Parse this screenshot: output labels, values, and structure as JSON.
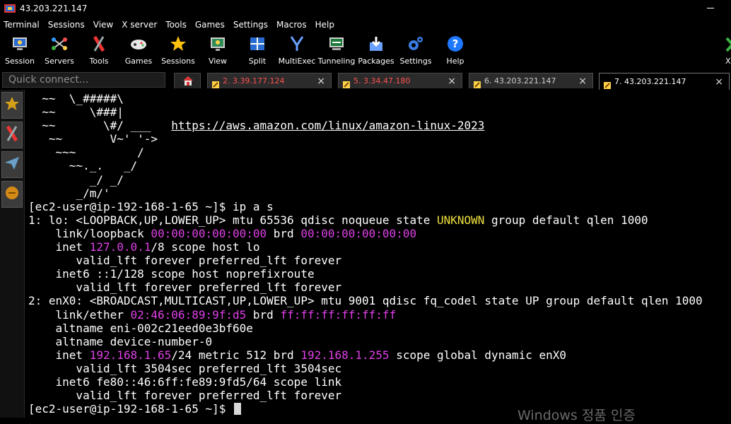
{
  "window": {
    "title": "43.203.221.147"
  },
  "menu": [
    "Terminal",
    "Sessions",
    "View",
    "X server",
    "Tools",
    "Games",
    "Settings",
    "Macros",
    "Help"
  ],
  "toolbar": [
    {
      "label": "Session",
      "icon": "session-icon"
    },
    {
      "label": "Servers",
      "icon": "servers-icon"
    },
    {
      "label": "Tools",
      "icon": "tools-icon"
    },
    {
      "label": "Games",
      "icon": "games-icon"
    },
    {
      "label": "Sessions",
      "icon": "sessions-star-icon"
    },
    {
      "label": "View",
      "icon": "view-icon"
    },
    {
      "label": "Split",
      "icon": "split-icon"
    },
    {
      "label": "MultiExec",
      "icon": "multiexec-icon"
    },
    {
      "label": "Tunneling",
      "icon": "tunneling-icon"
    },
    {
      "label": "Packages",
      "icon": "packages-icon"
    },
    {
      "label": "Settings",
      "icon": "settings-icon"
    },
    {
      "label": "Help",
      "icon": "help-icon"
    }
  ],
  "toolbar_right": {
    "label": "X se",
    "icon": "x-server-icon"
  },
  "quick_connect": {
    "placeholder": "Quick connect..."
  },
  "tabs": [
    {
      "label": "2. 3.39.177.124",
      "color": "#ff5050",
      "active": false
    },
    {
      "label": "5. 3.34.47.180",
      "color": "#ff5050",
      "active": false
    },
    {
      "label": "6. 43.203.221.147",
      "color": "#cfcfcf",
      "active": false
    },
    {
      "label": "7. 43.203.221.147",
      "color": "#ffffff",
      "active": true
    }
  ],
  "sidebar": [
    {
      "icon": "star-icon"
    },
    {
      "icon": "tools-icon"
    },
    {
      "icon": "send-icon"
    },
    {
      "icon": "macros-icon"
    }
  ],
  "terminal": {
    "lines": [
      [
        {
          "t": "  ~~  \\_#####\\"
        }
      ],
      [
        {
          "t": "  ~~     \\###|"
        }
      ],
      [
        {
          "t": "  ~~       \\#/ ___   "
        },
        {
          "t": "https://aws.amazon.com/linux/amazon-linux-2023",
          "s": "url"
        }
      ],
      [
        {
          "t": "   ~~       V~' '->"
        }
      ],
      [
        {
          "t": "    ~~~         /"
        }
      ],
      [
        {
          "t": "      ~~._.   _/"
        }
      ],
      [
        {
          "t": "         _/ _/"
        }
      ],
      [
        {
          "t": "       _/m/'"
        }
      ],
      [
        {
          "t": "[ec2-user@ip-192-168-1-65 ~]$ ip a s"
        }
      ],
      [
        {
          "t": "1: lo: <LOOPBACK,UP,LOWER_UP> mtu 65536 qdisc noqueue state "
        },
        {
          "t": "UNKNOWN",
          "s": "yel"
        },
        {
          "t": " group default qlen 1000"
        }
      ],
      [
        {
          "t": "    link/loopback "
        },
        {
          "t": "00:00:00:00:00:00",
          "s": "mag"
        },
        {
          "t": " brd "
        },
        {
          "t": "00:00:00:00:00:00",
          "s": "mag"
        }
      ],
      [
        {
          "t": "    inet "
        },
        {
          "t": "127.0.0.1",
          "s": "mag"
        },
        {
          "t": "/8 scope host lo"
        }
      ],
      [
        {
          "t": "       valid_lft forever preferred_lft forever"
        }
      ],
      [
        {
          "t": "    inet6 ::1/128 scope host noprefixroute"
        }
      ],
      [
        {
          "t": "       valid_lft forever preferred_lft forever"
        }
      ],
      [
        {
          "t": "2: enX0: <BROADCAST,MULTICAST,UP,LOWER_UP> mtu 9001 qdisc fq_codel state UP group default qlen 1000"
        }
      ],
      [
        {
          "t": "    link/ether "
        },
        {
          "t": "02:46:06:89:9f:d5",
          "s": "mag"
        },
        {
          "t": " brd "
        },
        {
          "t": "ff:ff:ff:ff:ff:ff",
          "s": "mag"
        }
      ],
      [
        {
          "t": "    altname eni-002c21eed0e3bf60e"
        }
      ],
      [
        {
          "t": "    altname device-number-0"
        }
      ],
      [
        {
          "t": "    inet "
        },
        {
          "t": "192.168.1.65",
          "s": "mag"
        },
        {
          "t": "/24 metric 512 brd "
        },
        {
          "t": "192.168.1.255",
          "s": "mag"
        },
        {
          "t": " scope global dynamic enX0"
        }
      ],
      [
        {
          "t": "       valid_lft 3504sec preferred_lft 3504sec"
        }
      ],
      [
        {
          "t": "    inet6 fe80::46:6ff:fe89:9fd5/64 scope link"
        }
      ],
      [
        {
          "t": "       valid_lft forever preferred_lft forever"
        }
      ],
      [
        {
          "t": "[ec2-user@ip-192-168-1-65 ~]$ "
        }
      ]
    ]
  },
  "watermark": "Windows 정품 인증"
}
